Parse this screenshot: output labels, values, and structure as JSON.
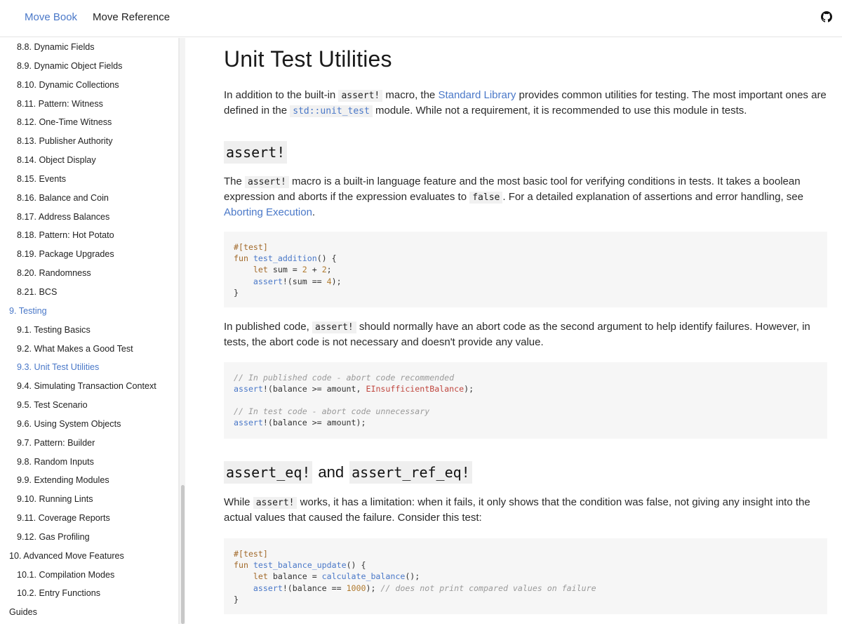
{
  "topnav": {
    "book": "Move Book",
    "reference": "Move Reference"
  },
  "sidebar": {
    "items": [
      {
        "label": "8.8. Dynamic Fields",
        "level": 2
      },
      {
        "label": "8.9. Dynamic Object Fields",
        "level": 2
      },
      {
        "label": "8.10. Dynamic Collections",
        "level": 2
      },
      {
        "label": "8.11. Pattern: Witness",
        "level": 2
      },
      {
        "label": "8.12. One-Time Witness",
        "level": 2
      },
      {
        "label": "8.13. Publisher Authority",
        "level": 2
      },
      {
        "label": "8.14. Object Display",
        "level": 2
      },
      {
        "label": "8.15. Events",
        "level": 2
      },
      {
        "label": "8.16. Balance and Coin",
        "level": 2
      },
      {
        "label": "8.17. Address Balances",
        "level": 2
      },
      {
        "label": "8.18. Pattern: Hot Potato",
        "level": 2
      },
      {
        "label": "8.19. Package Upgrades",
        "level": 2
      },
      {
        "label": "8.20. Randomness",
        "level": 2
      },
      {
        "label": "8.21. BCS",
        "level": 2
      },
      {
        "label": "9. Testing",
        "level": 1
      },
      {
        "label": "9.1. Testing Basics",
        "level": 2
      },
      {
        "label": "9.2. What Makes a Good Test",
        "level": 2
      },
      {
        "label": "9.3. Unit Test Utilities",
        "level": 2
      },
      {
        "label": "9.4. Simulating Transaction Context",
        "level": 2
      },
      {
        "label": "9.5. Test Scenario",
        "level": 2
      },
      {
        "label": "9.6. Using System Objects",
        "level": 2
      },
      {
        "label": "9.7. Pattern: Builder",
        "level": 2
      },
      {
        "label": "9.8. Random Inputs",
        "level": 2
      },
      {
        "label": "9.9. Extending Modules",
        "level": 2
      },
      {
        "label": "9.10. Running Lints",
        "level": 2
      },
      {
        "label": "9.11. Coverage Reports",
        "level": 2
      },
      {
        "label": "9.12. Gas Profiling",
        "level": 2
      },
      {
        "label": "10. Advanced Move Features",
        "level": 1
      },
      {
        "label": "10.1. Compilation Modes",
        "level": 2
      },
      {
        "label": "10.2. Entry Functions",
        "level": 2
      },
      {
        "label": "Guides",
        "level": 1
      }
    ],
    "active_index": 17,
    "active_section_index": 14
  },
  "page": {
    "title": "Unit Test Utilities",
    "intro": {
      "t1": "In addition to the built-in ",
      "c1": "assert!",
      "t2": " macro, the ",
      "link1": "Standard Library",
      "t3": " provides common utilities for testing. The most important ones are defined in the ",
      "c2": "std::unit_test",
      "t4": " module. While not a requirement, it is recommended to use this module in tests."
    },
    "h_assert": "assert!",
    "assert_para": {
      "t1": "The ",
      "c1": "assert!",
      "t2": " macro is a built-in language feature and the most basic tool for verifying conditions in tests. It takes a boolean expression and aborts if the expression evaluates to ",
      "c2": "false",
      "t3": ". For a detailed explanation of assertions and error handling, see ",
      "link": "Aborting Execution",
      "t4": "."
    },
    "published_para": {
      "t1": "In published code, ",
      "c1": "assert!",
      "t2": " should normally have an abort code as the second argument to help identify failures. However, in tests, the abort code is not necessary and doesn't provide any value."
    },
    "h_eq": {
      "c1": "assert_eq!",
      "mid": "and",
      "c2": "assert_ref_eq!"
    },
    "while_para": {
      "t1": "While ",
      "c1": "assert!",
      "t2": " works, it has a limitation: when it fails, it only shows that the condition was false, not giving any insight into the actual values that caused the failure. Consider this test:"
    },
    "code1": {
      "attr": "#[test]",
      "fun": "fun",
      "name": "test_addition",
      "rest1": "() {",
      "let": "let",
      "l2a": " sum = ",
      "n1": "2",
      "l2b": " + ",
      "n2": "2",
      "l2c": ";",
      "assert": "assert",
      "l3a": "!(sum == ",
      "n3": "4",
      "l3b": ");",
      "close": "}"
    },
    "code2": {
      "c1": "// In published code - abort code recommended",
      "assert1": "assert",
      "l1a": "!(balance >= amount, ",
      "err": "EInsufficientBalance",
      "l1b": ");",
      "c2": "// In test code - abort code unnecessary",
      "assert2": "assert",
      "l2a": "!(balance >= amount);"
    },
    "code3": {
      "attr": "#[test]",
      "fun": "fun",
      "name": "test_balance_update",
      "rest1": "() {",
      "let": "let",
      "l2a": " balance = ",
      "call": "calculate_balance",
      "l2b": "();",
      "assert": "assert",
      "l3a": "!(balance == ",
      "num": "1000",
      "l3b": "); ",
      "cm": "// does not print compared values on failure",
      "close": "}"
    }
  },
  "colors": {
    "accent": "#4a78c8",
    "code_bg": "#f6f6f6",
    "keyword": "#a26a2b",
    "error_const": "#c0473f"
  },
  "icons": {
    "github": "github-icon"
  }
}
